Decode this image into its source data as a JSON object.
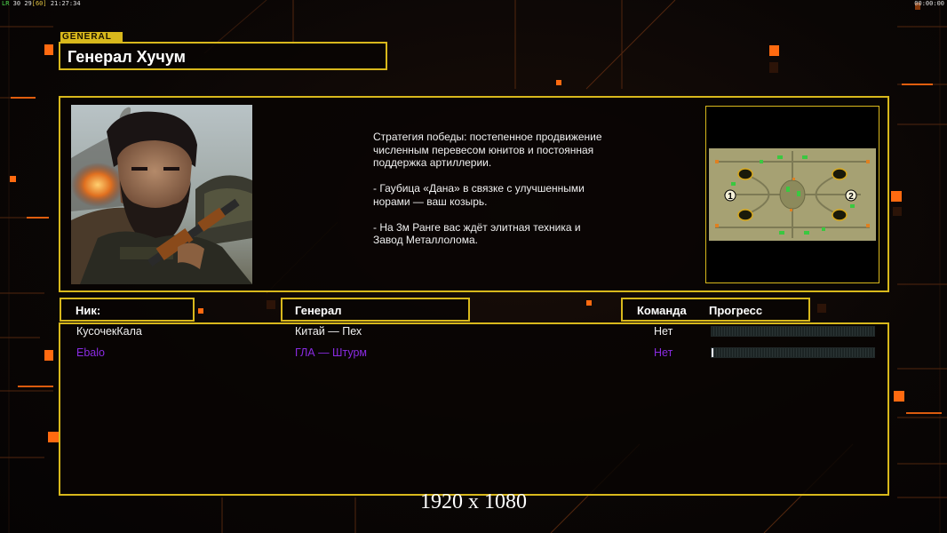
{
  "hud": {
    "left_tag": "LR",
    "left_fps": "30",
    "left_num": "29",
    "left_bracket": "[60]",
    "left_time": "21:27:34",
    "right_time": "00:00:00"
  },
  "header": {
    "tag": "GENERAL",
    "title": "Генерал Хучум"
  },
  "description": {
    "lines": [
      "Стратегия победы: постепенное продвижение численным перевесом юнитов и постоянная поддержка артиллерии.",
      "- Гаубица «Дана» в связке с улучшенными норами — ваш козырь.",
      "- На 3м Ранге вас ждёт элитная техника и Завод Металлолома."
    ]
  },
  "map": {
    "spawn_1": "1",
    "spawn_2": "2"
  },
  "columns": {
    "nick": "Ник:",
    "general": "Генерал",
    "team": "Команда",
    "progress": "Прогресс"
  },
  "players": [
    {
      "nick": "КусочекКала",
      "general": "Китай — Пех",
      "team": "Нет",
      "progress": 0,
      "color": "#f0f0f0"
    },
    {
      "nick": "Ebalo",
      "general": "ГЛА — Штурм",
      "team": "Нет",
      "progress": 0.01,
      "color": "#8a2be2"
    }
  ],
  "colors": {
    "frame": "#d8b81c",
    "accent": "#ff6a10"
  },
  "footer": {
    "resolution": "1920 x 1080"
  }
}
